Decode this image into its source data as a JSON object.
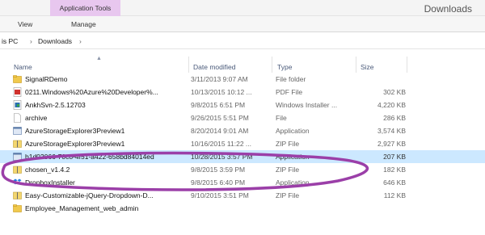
{
  "titlebar": {
    "context_tab": "Application Tools",
    "title": "Downloads"
  },
  "ribbon": {
    "tabs": [
      "View",
      "Manage"
    ]
  },
  "address": {
    "pc": "is PC",
    "sep": "›",
    "folder": "Downloads"
  },
  "columns": {
    "name": "Name",
    "date": "Date modified",
    "type": "Type",
    "size": "Size"
  },
  "files": [
    {
      "name": "SignalRDemo",
      "date": "3/11/2013 9:07 AM",
      "type": "File folder",
      "size": "",
      "icon": "folder-icon"
    },
    {
      "name": "0211.Windows%20Azure%20Developer%...",
      "date": "10/13/2015 10:12 ...",
      "type": "PDF File",
      "size": "302 KB",
      "icon": "pdf-icon"
    },
    {
      "name": "AnkhSvn-2.5.12703",
      "date": "9/8/2015 6:51 PM",
      "type": "Windows Installer ...",
      "size": "4,220 KB",
      "icon": "installer-icon"
    },
    {
      "name": "archive",
      "date": "9/26/2015 5:51 PM",
      "type": "File",
      "size": "286 KB",
      "icon": "file-icon"
    },
    {
      "name": "AzureStorageExplorer3Preview1",
      "date": "8/20/2014 9:01 AM",
      "type": "Application",
      "size": "3,574 KB",
      "icon": "application-icon"
    },
    {
      "name": "AzureStorageExplorer3Preview1",
      "date": "10/16/2015 11:22 ...",
      "type": "ZIP File",
      "size": "2,927 KB",
      "icon": "zip-icon"
    },
    {
      "name": "b1d02066-70c8-4f51-a422-658bd84014ed",
      "date": "10/28/2015 3:57 PM",
      "type": "Application",
      "size": "207 KB",
      "icon": "application-icon",
      "selected": true
    },
    {
      "name": "chosen_v1.4.2",
      "date": "9/8/2015 3:59 PM",
      "type": "ZIP File",
      "size": "182 KB",
      "icon": "zip-icon"
    },
    {
      "name": "DropboxInstaller",
      "date": "9/8/2015 6:40 PM",
      "type": "Application",
      "size": "646 KB",
      "icon": "dropbox-icon"
    },
    {
      "name": "Easy-Customizable-jQuery-Dropdown-D...",
      "date": "9/10/2015 3:51 PM",
      "type": "ZIP File",
      "size": "112 KB",
      "icon": "zip-icon"
    },
    {
      "name": "Employee_Management_web_admin",
      "date": "",
      "type": "",
      "size": "",
      "icon": "folder-icon"
    }
  ],
  "colors": {
    "context_tab": "#e8c7ef",
    "selection": "#cce8ff",
    "annotation_oval": "#9b3fa8"
  }
}
